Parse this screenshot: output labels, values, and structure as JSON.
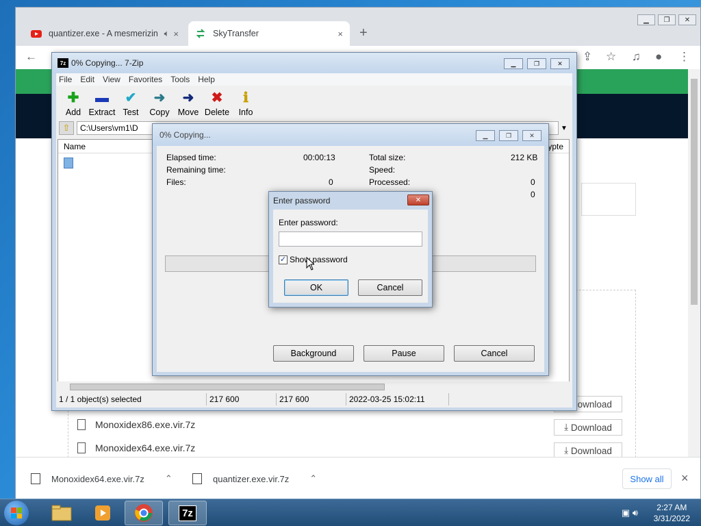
{
  "browser": {
    "tabs": [
      {
        "label": "quantizer.exe - A mesmerizin",
        "icon": "youtube-icon"
      },
      {
        "label": "SkyTransfer",
        "icon": "skytransfer-icon"
      }
    ],
    "new_tab": "+",
    "close_glyph": "×",
    "downloads": [
      {
        "name": "Monoxidex86.exe.vir.7z",
        "button": "Download"
      },
      {
        "name": "Monoxidex64.exe.vir.7z",
        "button": "Download"
      }
    ],
    "partial_download_label": "Download",
    "shelf": [
      {
        "name": "Monoxidex64.exe.vir.7z"
      },
      {
        "name": "quantizer.exe.vir.7z"
      }
    ],
    "show_all": "Show all"
  },
  "sevenzip": {
    "title": "0% Copying... 7-Zip",
    "menu": [
      "File",
      "Edit",
      "View",
      "Favorites",
      "Tools",
      "Help"
    ],
    "toolbar": [
      {
        "label": "Add",
        "glyph": "✚",
        "color": "#1aa31a"
      },
      {
        "label": "Extract",
        "glyph": "▬",
        "color": "#1a3ab8"
      },
      {
        "label": "Test",
        "glyph": "✔",
        "color": "#22a8c8"
      },
      {
        "label": "Copy",
        "glyph": "➜",
        "color": "#2a7a8a"
      },
      {
        "label": "Move",
        "glyph": "➜",
        "color": "#12287a"
      },
      {
        "label": "Delete",
        "glyph": "✖",
        "color": "#d01a1a"
      },
      {
        "label": "Info",
        "glyph": "ℹ",
        "color": "#c8a000"
      }
    ],
    "address": "C:\\Users\\vm1\\D",
    "columns": {
      "name": "Name",
      "crypted": "Encrypte"
    },
    "status": {
      "selected": "1 / 1 object(s) selected",
      "size": "217 600",
      "packed": "217 600",
      "modified": "2022-03-25 15:02:11"
    }
  },
  "progress": {
    "title": "0% Copying...",
    "elapsed_label": "Elapsed time:",
    "elapsed_value": "00:00:13",
    "remaining_label": "Remaining time:",
    "files_label": "Files:",
    "files_value": "0",
    "total_label": "Total size:",
    "total_value": "212 KB",
    "speed_label": "Speed:",
    "processed_label": "Processed:",
    "processed_value": "0",
    "extra_value": "0",
    "percent": 0,
    "buttons": {
      "background": "Background",
      "pause": "Pause",
      "cancel": "Cancel"
    }
  },
  "password_dialog": {
    "title": "Enter password",
    "label": "Enter password:",
    "value": "",
    "show_password_label": "Show password",
    "show_password_checked": true,
    "ok": "OK",
    "cancel": "Cancel"
  },
  "taskbar": {
    "time": "2:27 AM",
    "date": "3/31/2022",
    "sevenzip_label": "7z"
  }
}
